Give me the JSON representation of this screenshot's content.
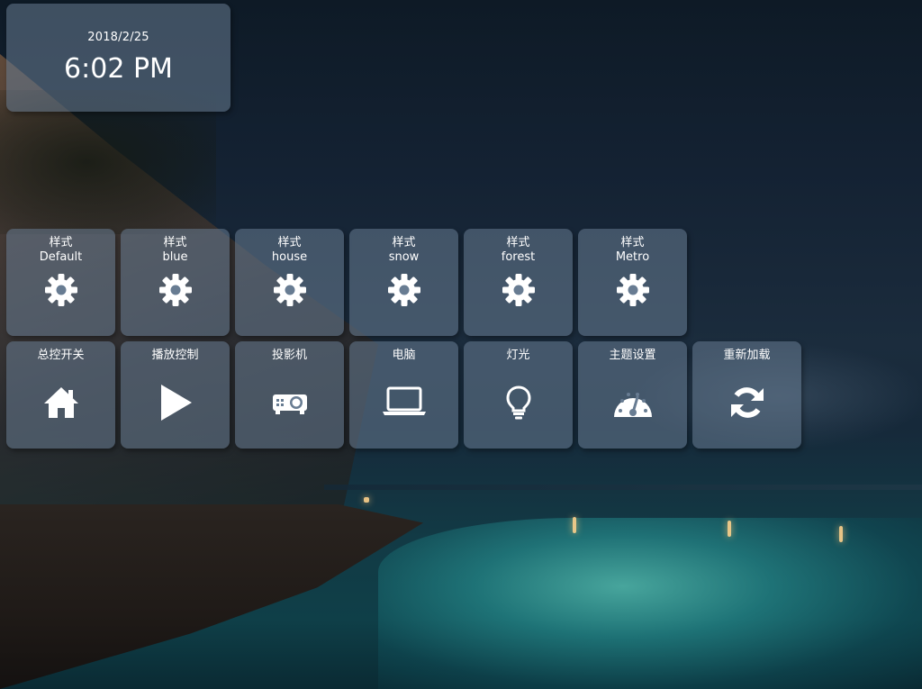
{
  "clock": {
    "date": "2018/2/25",
    "time": "6:02 PM"
  },
  "styles": [
    {
      "title": "样式",
      "name": "Default",
      "icon": "gear-icon"
    },
    {
      "title": "样式",
      "name": "blue",
      "icon": "gear-icon"
    },
    {
      "title": "样式",
      "name": "house",
      "icon": "gear-icon"
    },
    {
      "title": "样式",
      "name": "snow",
      "icon": "gear-icon"
    },
    {
      "title": "样式",
      "name": "forest",
      "icon": "gear-icon"
    },
    {
      "title": "样式",
      "name": "Metro",
      "icon": "gear-icon"
    }
  ],
  "controls": [
    {
      "label": "总控开关",
      "icon": "home-icon"
    },
    {
      "label": "播放控制",
      "icon": "play-icon"
    },
    {
      "label": "投影机",
      "icon": "projector-icon"
    },
    {
      "label": "电脑",
      "icon": "laptop-icon"
    },
    {
      "label": "灯光",
      "icon": "lightbulb-icon"
    },
    {
      "label": "主题设置",
      "icon": "dashboard-icon"
    },
    {
      "label": "重新加载",
      "icon": "refresh-icon"
    }
  ],
  "colors": {
    "tile_background": "#687c92",
    "text": "#ffffff"
  }
}
